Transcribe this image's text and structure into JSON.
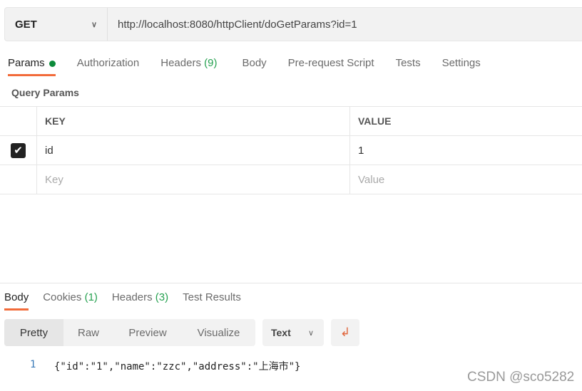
{
  "request": {
    "method": "GET",
    "url": "http://localhost:8080/httpClient/doGetParams?id=1"
  },
  "request_tabs": [
    {
      "label": "Params"
    },
    {
      "label": "Authorization"
    },
    {
      "label": "Headers",
      "count": "(9)"
    },
    {
      "label": "Body"
    },
    {
      "label": "Pre-request Script"
    },
    {
      "label": "Tests"
    },
    {
      "label": "Settings"
    }
  ],
  "query_params": {
    "title": "Query Params",
    "headers": [
      "KEY",
      "VALUE"
    ],
    "rows": [
      {
        "checked": true,
        "key": "id",
        "value": "1"
      }
    ],
    "placeholder": {
      "key": "Key",
      "value": "Value"
    }
  },
  "response_tabs": [
    {
      "label": "Body"
    },
    {
      "label": "Cookies",
      "count": "(1)"
    },
    {
      "label": "Headers",
      "count": "(3)"
    },
    {
      "label": "Test Results"
    }
  ],
  "view_modes": [
    "Pretty",
    "Raw",
    "Preview",
    "Visualize"
  ],
  "format": "Text",
  "response_body": {
    "line": "1",
    "text": "{\"id\":\"1\",\"name\":\"zzc\",\"address\":\"上海市\"}"
  },
  "watermark": "CSDN @sco5282",
  "colors": {
    "accent": "#f26b3a",
    "green": "#26a150"
  }
}
